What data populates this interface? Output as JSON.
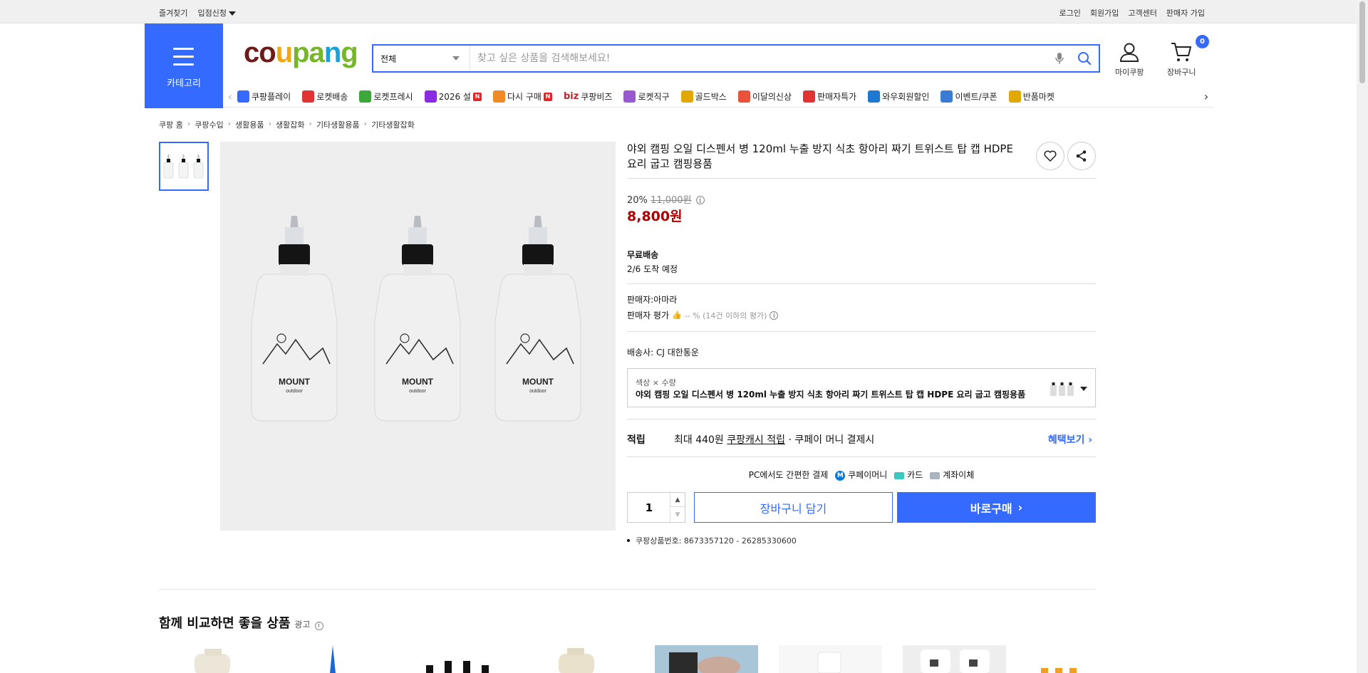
{
  "topbar": {
    "left": [
      "즐겨찾기",
      "입점신청"
    ],
    "right": [
      "로그인",
      "회원가입",
      "고객센터",
      "판매자 가입"
    ]
  },
  "header": {
    "category_label": "카테고리",
    "logo": [
      "co",
      "u",
      "pa",
      "n",
      "g"
    ],
    "search_scope": "전체",
    "search_placeholder": "찾고 싶은 상품을 검색해보세요!",
    "mycoupang": "마이쿠팡",
    "cart": "장바구니",
    "cart_count": "0"
  },
  "gnb": [
    {
      "label": "쿠팡플레이",
      "icon": "play-icon",
      "color": "#346aff"
    },
    {
      "label": "로켓배송",
      "icon": "rocket-icon",
      "color": "#e03434"
    },
    {
      "label": "로켓프레시",
      "icon": "rocket-fresh-icon",
      "color": "#3ca83c"
    },
    {
      "label": "2026 설",
      "icon": "gift-icon",
      "color": "#8a2be2",
      "badge": "N"
    },
    {
      "label": "다시 구매",
      "icon": "home-icon",
      "color": "#f08a24",
      "badge": "N"
    },
    {
      "label": "쿠팡비즈",
      "icon": "biz-icon",
      "color": "#b0292e",
      "prefix": "biz"
    },
    {
      "label": "로켓직구",
      "icon": "globe-icon",
      "color": "#9b59d0"
    },
    {
      "label": "골드박스",
      "icon": "goldbox-icon",
      "color": "#e0a800"
    },
    {
      "label": "이달의신상",
      "icon": "new-icon",
      "color": "#e8523a"
    },
    {
      "label": "판매자특가",
      "icon": "percent-icon",
      "color": "#e03434"
    },
    {
      "label": "와우회원할인",
      "icon": "wow-icon",
      "color": "#1f78d1"
    },
    {
      "label": "이벤트/쿠폰",
      "icon": "coupon-icon",
      "color": "#3a7bd5"
    },
    {
      "label": "반품마켓",
      "icon": "market-icon",
      "color": "#e0a800"
    }
  ],
  "breadcrumb": [
    "쿠팡 홈",
    "쿠팡수입",
    "생활용품",
    "생활잡화",
    "기타생활용품",
    "기타생활잡화"
  ],
  "product": {
    "title": "야외 캠핑 오일 디스펜서 병 120ml 누출 방지 식초 항아리 짜기 트위스트 탑 캡 HDPE 요리 굽고 캠핑용품",
    "discount_rate": "20%",
    "original_price": "11,000원",
    "price": "8,800원",
    "shipping_title": "무료배송",
    "shipping_eta": "2/6 도착 예정",
    "seller": "판매자:아마라",
    "seller_rating_label": "판매자 평가",
    "seller_rating_value": "-- % (14건 이하의 평가)",
    "carrier": "배송사:  CJ 대한통운",
    "option_label": "색상 × 수량",
    "option_value": "야외 캠핑 오일 디스펜서 병 120ml 누출 방지 식초 항아리 짜기 트위스트 탑 캡 HDPE 요리 굽고 캠핑용품",
    "reward_title": "적립",
    "reward_prefix": "최대 440원",
    "reward_link": "쿠팡캐시 적립",
    "reward_suffix": "· 쿠페이 머니 결제시",
    "reward_more": "혜택보기",
    "pay_title": "PC에서도 간편한 결제",
    "pay_methods": [
      "쿠페이머니",
      "카드",
      "계좌이체"
    ],
    "qty": "1",
    "cart_button": "장바구니 담기",
    "buy_button": "바로구매",
    "product_id_label": "쿠팡상품번호: 8673357120 - 26285330600",
    "bottle_brand": "MOUNT",
    "bottle_sub": "outdoor",
    "product_color": "#f0f0f0"
  },
  "recommend": {
    "title": "함께 비교하면 좋을 상품",
    "ad": "광고"
  },
  "colors": {
    "accent": "#346aff",
    "price": "#ae0000"
  }
}
